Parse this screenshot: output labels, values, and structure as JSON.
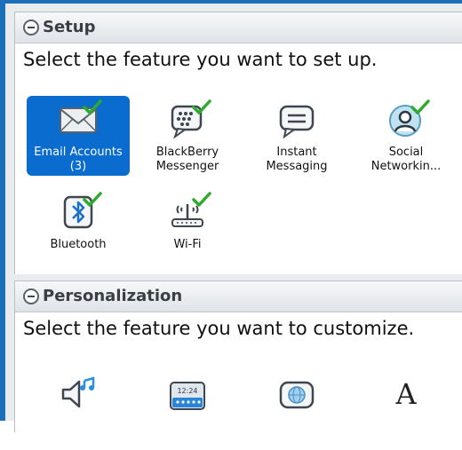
{
  "setup": {
    "title": "Setup",
    "description": "Select the feature you want to set up.",
    "items": [
      {
        "label": "Email Accounts (3)",
        "icon": "envelope-icon",
        "selected": true,
        "configured": true
      },
      {
        "label": "BlackBerry Messenger",
        "icon": "bbm-chat-icon",
        "configured": true
      },
      {
        "label": "Instant Messaging",
        "icon": "chat-bubble-icon",
        "configured": false
      },
      {
        "label": "Social Networkin...",
        "icon": "social-person-icon",
        "configured": true
      },
      {
        "label": "Bluetooth",
        "icon": "bluetooth-icon",
        "configured": true
      },
      {
        "label": "Wi-Fi",
        "icon": "wifi-router-icon",
        "configured": true
      }
    ]
  },
  "personalization": {
    "title": "Personalization",
    "description": "Select the feature you want to customize.",
    "items": [
      {
        "icon": "sound-music-icon"
      },
      {
        "icon": "homescreen-clock-icon",
        "clock_text": "12:24"
      },
      {
        "icon": "globe-chat-icon"
      },
      {
        "icon": "font-letter-icon",
        "glyph": "A"
      }
    ]
  },
  "colors": {
    "accent": "#0b6ccf",
    "check": "#2faa2f",
    "header_text": "#3a3f46"
  }
}
